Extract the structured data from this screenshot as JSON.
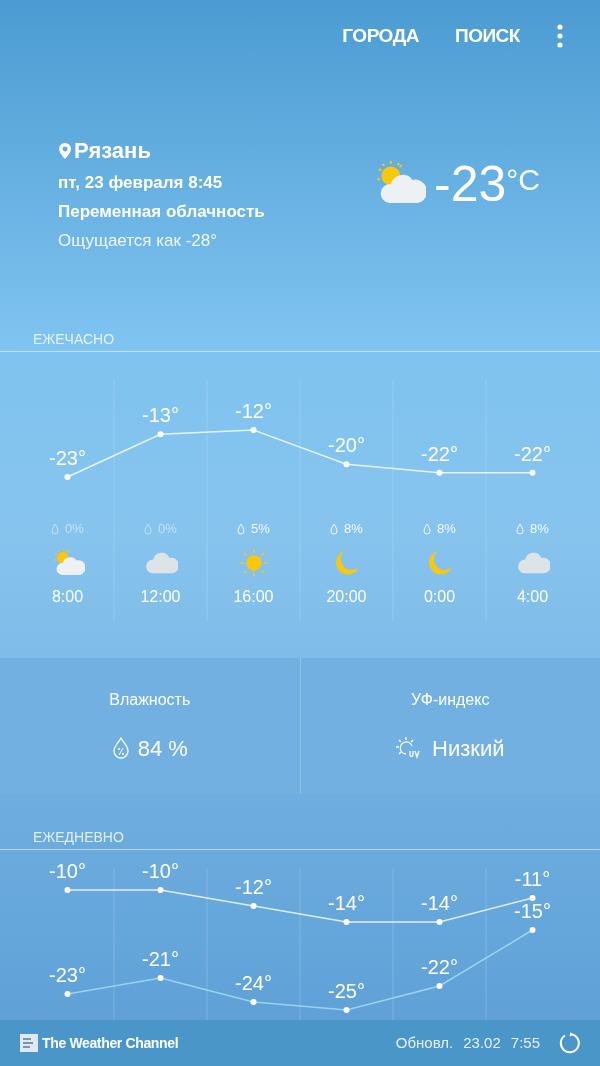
{
  "top_bar": {
    "actions": [
      "ГОРОДА",
      "ПОИСК"
    ]
  },
  "current": {
    "location": "Рязань",
    "date": "пт, 23 февраля 8:45",
    "condition": "Переменная облачность",
    "feels_like": "Ощущается как -28°",
    "kind": "partly-cloudy",
    "temperature": "-23",
    "unit": "°C"
  },
  "hourly": {
    "title": "ЕЖЕЧАСНО",
    "chart_data": {
      "type": "line",
      "categories": [
        "8:00",
        "12:00",
        "16:00",
        "20:00",
        "0:00",
        "4:00"
      ],
      "series": [
        {
          "color": "#ffffff",
          "marker": true,
          "values": [
            -23,
            -13,
            -12,
            -20,
            -22,
            -22
          ],
          "value_labels": [
            "-23°",
            "-13°",
            "-12°",
            "-20°",
            "-22°",
            "-22°"
          ]
        }
      ]
    },
    "hours": [
      {
        "precipitation": "0%",
        "faded": true,
        "kind": "partly-cloudy"
      },
      {
        "precipitation": "0%",
        "faded": true,
        "kind": "cloudy"
      },
      {
        "precipitation": "5%",
        "faded": false,
        "kind": "sunny"
      },
      {
        "precipitation": "8%",
        "faded": false,
        "kind": "moon"
      },
      {
        "precipitation": "8%",
        "faded": false,
        "kind": "moon"
      },
      {
        "precipitation": "8%",
        "faded": false,
        "kind": "cloudy"
      }
    ]
  },
  "details": [
    {
      "label": "Влажность",
      "value": "84 %",
      "kind": "humidity"
    },
    {
      "label": "УФ-индекс",
      "value": "Низкий",
      "kind": "uv"
    }
  ],
  "daily": {
    "title": "ЕЖЕДНЕВНО",
    "chart_data": {
      "type": "line",
      "series": [
        {
          "color": "#ffffff",
          "marker": true,
          "values": [
            -10,
            -10,
            -12,
            -14,
            -14,
            -11
          ],
          "value_labels": [
            "-10°",
            "-10°",
            "-12°",
            "-14°",
            "-14°",
            "-11°"
          ]
        },
        {
          "color": "#a8e0f0",
          "marker": true,
          "values": [
            -23,
            -21,
            -24,
            -25,
            -22,
            -15
          ],
          "value_labels": [
            "-23°",
            "-21°",
            "-24°",
            "-25°",
            "-22°",
            "-15°"
          ]
        }
      ]
    }
  },
  "footer": {
    "brand": "The Weather Channel",
    "updated_label": "Обновл.",
    "updated_date": "23.02",
    "updated_time": "7:55"
  }
}
